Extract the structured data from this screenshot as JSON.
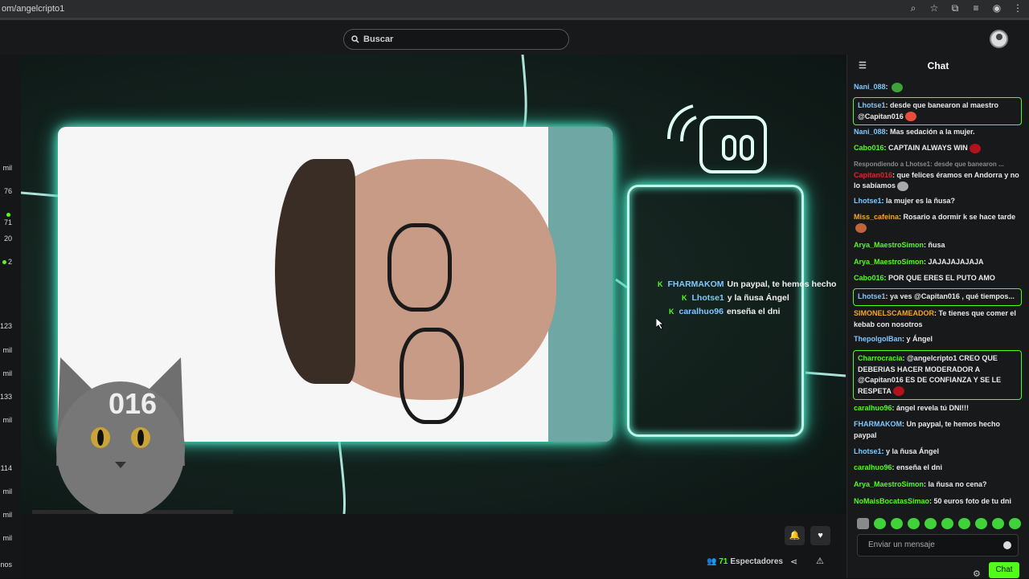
{
  "browser": {
    "url": "om/angelcripto1",
    "icons": [
      "zoom-icon",
      "star-icon",
      "extensions-icon",
      "media-icon",
      "profile-icon",
      "menu-icon"
    ]
  },
  "search": {
    "placeholder": "Buscar"
  },
  "left_rail": {
    "values": [
      "mil",
      "76",
      "71",
      "20",
      "2",
      "123",
      "mil",
      "mil",
      "133",
      "mil",
      "114",
      "mil",
      "mil",
      "mil",
      "nos"
    ],
    "live_dots": [
      false,
      false,
      true,
      false,
      true,
      false,
      false,
      false,
      false,
      false,
      false,
      false,
      false,
      false,
      false
    ]
  },
  "overlay_chat": [
    {
      "user": "FHARMAKOM",
      "text": "Un paypal, te hemos hecho"
    },
    {
      "user": "Lhotse1",
      "text": "y la ñusa Ángel"
    },
    {
      "user": "caralhuo96",
      "text": "enseña el dni"
    }
  ],
  "cat_badge": "016",
  "stream": {
    "viewers": "71",
    "viewers_label": "Espectadores"
  },
  "chat": {
    "title": "Chat",
    "messages": [
      {
        "user": "Nani_088",
        "color": "#7ec8ff",
        "text": "",
        "emote": "#3fa13a"
      },
      {
        "user": "Lhotse1",
        "color": "#7ec8ff",
        "text": "desde que banearon al maestro @Capitan016",
        "highlight": true,
        "emote": "#e84c3d"
      },
      {
        "user": "Nani_088",
        "color": "#7ec8ff",
        "text": "Mas sedación a la mujer."
      },
      {
        "user": "Cabo016",
        "color": "#53fc18",
        "text": "CAPTAIN ALWAYS WIN",
        "emote": "#b1121c"
      },
      {
        "reply": "Respondiendo a Lhotse1: desde que banearon ...",
        "user": "Capitan016",
        "color": "#e0242b",
        "text": "que felices éramos en Andorra y no lo sabíamos",
        "emote": "#a9a9a9"
      },
      {
        "user": "Lhotse1",
        "color": "#7ec8ff",
        "text": "la mujer es la ñusa?"
      },
      {
        "user": "Miss_cafeina",
        "color": "#f5a623",
        "text": "Rosario a dormir k se hace tarde",
        "emote": "#c0643a"
      },
      {
        "user": "Arya_MaestroSimon",
        "color": "#53fc18",
        "text": "ñusa"
      },
      {
        "user": "Arya_MaestroSimon",
        "color": "#53fc18",
        "text": "JAJAJAJAJAJA"
      },
      {
        "user": "Cabo016",
        "color": "#53fc18",
        "text": "POR QUE ERES EL PUTO AMO"
      },
      {
        "user": "Lhotse1",
        "color": "#7ec8ff",
        "text": "ya ves @Capitan016 , qué tiempos...",
        "highlight": true
      },
      {
        "user": "SIMONELSCAMEADOR",
        "color": "#f5a623",
        "text": "Te tienes que comer el kebab con nosotros"
      },
      {
        "user": "ThepolgolBan",
        "color": "#7ec8ff",
        "text": "y Ángel"
      },
      {
        "user": "Charrocracia",
        "color": "#53fc18",
        "text": "@angelcripto1 CREO QUE DEBERIAS HACER MODERADOR A @Capitan016 ES DE CONFIANZA Y SE LE RESPETA",
        "highlight": true,
        "emote": "#b1121c"
      },
      {
        "user": "caralhuo96",
        "color": "#53fc18",
        "text": "ángel revela tú DNI!!!"
      },
      {
        "user": "FHARMAKOM",
        "color": "#7ec8ff",
        "text": "Un paypal, te hemos hecho paypal"
      },
      {
        "user": "Lhotse1",
        "color": "#7ec8ff",
        "text": "y la ñusa Ángel"
      },
      {
        "user": "caralhuo96",
        "color": "#53fc18",
        "text": "enseña el dni"
      },
      {
        "user": "Arya_MaestroSimon",
        "color": "#53fc18",
        "text": "la ñusa no cena?"
      },
      {
        "user": "NoMaisBocatasSimao",
        "color": "#53fc18",
        "text": "50 euros foto de tu dni"
      }
    ],
    "input_placeholder": "Enviar un mensaje",
    "send_label": "Chat"
  }
}
